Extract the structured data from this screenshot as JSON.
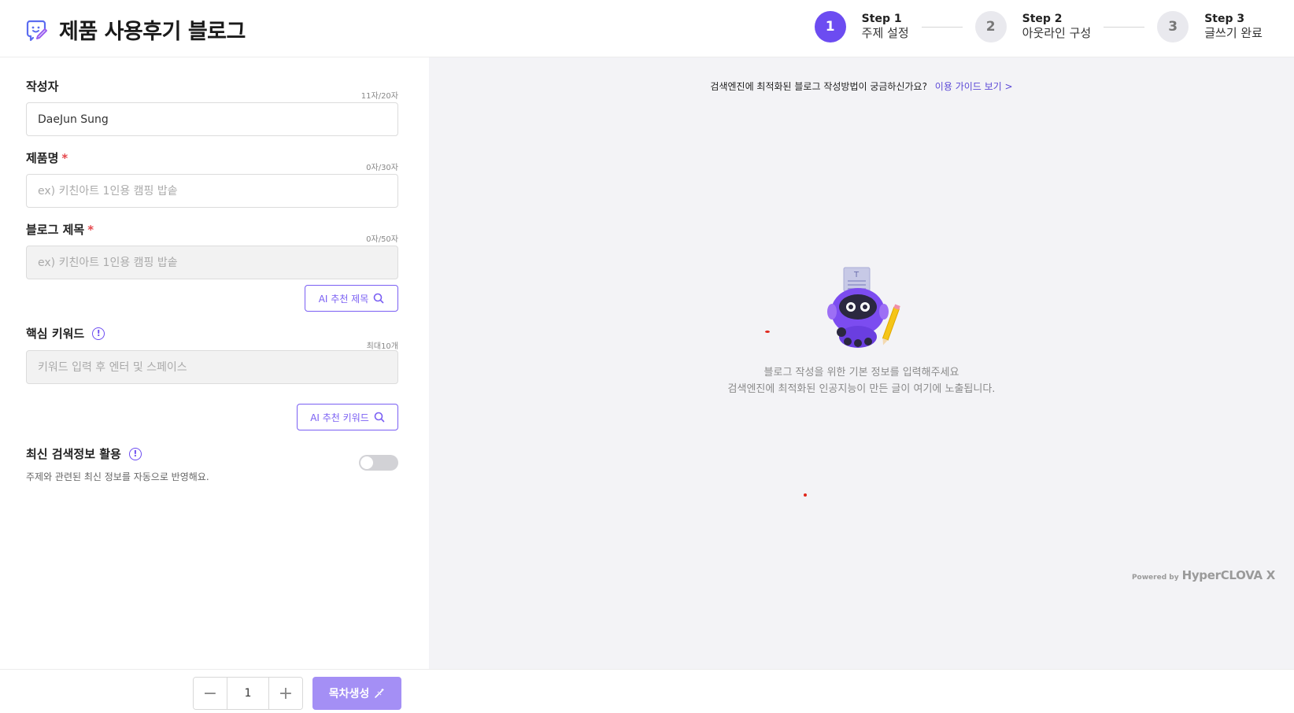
{
  "header": {
    "title": "제품 사용후기 블로그",
    "steps": [
      {
        "number": "1",
        "label": "Step 1",
        "name": "주제 설정",
        "active": true
      },
      {
        "number": "2",
        "label": "Step 2",
        "name": "아웃라인 구성",
        "active": false
      },
      {
        "number": "3",
        "label": "Step 3",
        "name": "글쓰기 완료",
        "active": false
      }
    ]
  },
  "form": {
    "author": {
      "label": "작성자",
      "counter": "11자/20자",
      "value": "DaeJun Sung"
    },
    "product": {
      "label": "제품명",
      "required": "*",
      "counter": "0자/30자",
      "placeholder": "ex) 키친아트 1인용 캠핑 밥솥"
    },
    "blog_title": {
      "label": "블로그 제목",
      "required": "*",
      "counter": "0자/50자",
      "placeholder": "ex) 키친아트 1인용 캠핑 밥솥",
      "ai_button": "AI 추천 제목"
    },
    "keywords": {
      "label": "핵심 키워드",
      "info": "!",
      "counter": "최대10개",
      "placeholder": "키워드 입력 후 엔터 및 스페이스",
      "ai_button": "AI 추천 키워드"
    },
    "latest_search": {
      "label": "최신 검색정보 활용",
      "info": "!",
      "description": "주제와 관련된 최신 정보를 자동으로 반영해요.",
      "enabled": false
    }
  },
  "preview": {
    "guide_text": "검색엔진에 최적화된 블로그 작성방법이 궁금하신가요?",
    "guide_link": "이용 가이드 보기 >",
    "empty_line1": "블로그 작성을 위한 기본 정보를 입력해주세요",
    "empty_line2": "검색엔진에 최적화된 인공지능이 만든 글이 여기에 노출됩니다.",
    "powered_by": "Powered by",
    "powered_brand": "HyperCLOVA X"
  },
  "footer": {
    "minus": "−",
    "count": "1",
    "plus": "+",
    "generate_label": "목차생성"
  },
  "colors": {
    "accent": "#6c4cf1",
    "generate_button": "#a48ff5",
    "required": "#e5484d"
  }
}
